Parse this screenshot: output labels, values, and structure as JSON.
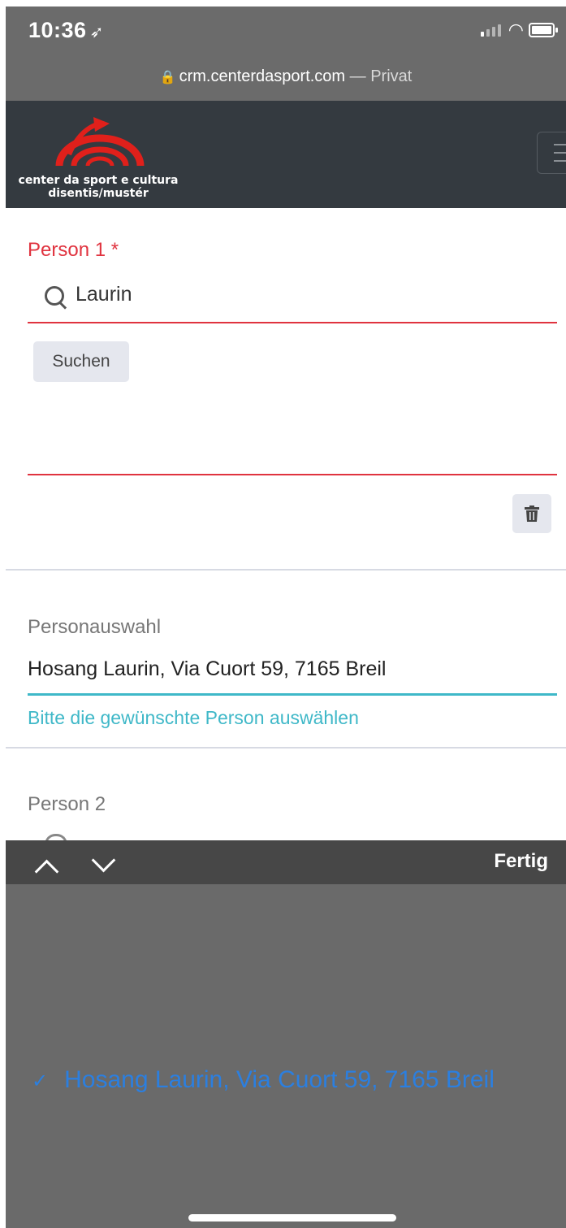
{
  "status_bar": {
    "time": "10:36",
    "location_icon": "location-arrow-icon",
    "url": "crm.centerdasport.com",
    "url_suffix": "— Privat"
  },
  "navbar": {
    "logo_line1": "center da sport e cultura",
    "logo_line2": "disentis/mustér",
    "logo_accent": "#e0201b",
    "menu_icon": "hamburger-icon"
  },
  "form": {
    "person1": {
      "label": "Person 1 *",
      "search_value": "Laurin",
      "search_button": "Suchen",
      "delete_icon": "trash-icon"
    },
    "personauswahl": {
      "label": "Personauswahl",
      "value": "Hosang Laurin, Via Cuort 59, 7165 Breil",
      "hint": "Bitte die gewünschte Person auswählen"
    },
    "person2": {
      "label": "Person 2"
    },
    "colors": {
      "error": "#e0333f",
      "focus": "#3fb8c8"
    }
  },
  "keyboard_toolbar": {
    "prev_icon": "chevron-up-icon",
    "next_icon": "chevron-down-icon",
    "done_label": "Fertig"
  },
  "picker": {
    "selected_option": "Hosang Laurin, Via Cuort 59, 7165 Breil",
    "check_mark": "✓"
  }
}
